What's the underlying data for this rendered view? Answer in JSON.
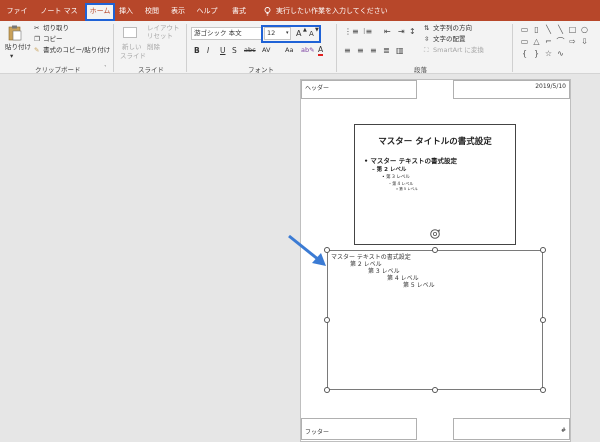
{
  "tabs": [
    {
      "label": "ファイル"
    },
    {
      "label": "ノート マスター"
    },
    {
      "label": "ホーム"
    },
    {
      "label": "挿入"
    },
    {
      "label": "校閲"
    },
    {
      "label": "表示"
    },
    {
      "label": "ヘルプ"
    },
    {
      "label": "書式"
    }
  ],
  "tellme": "実行したい作業を入力してください",
  "clipboard": {
    "paste": "貼り付け",
    "cut": "切り取り",
    "copy": "コピー",
    "format_painter": "書式のコピー/貼り付け",
    "group": "クリップボード"
  },
  "slides": {
    "new_slide": "新しい",
    "new_slide2": "スライド",
    "layout": "レイアウト",
    "reset": "リセット",
    "delete": "削除",
    "group": "スライド"
  },
  "font": {
    "name": "游ゴシック 本文",
    "size": "12",
    "grow": "A",
    "shrink": "A",
    "group": "フォント",
    "bold": "B",
    "italic": "I",
    "underline": "U",
    "shadow": "S",
    "strike": "abc",
    "spacing": "AV",
    "case": "Aa",
    "clear": "A"
  },
  "paragraph": {
    "text_direction": "文字列の方向",
    "align_text": "文字の配置",
    "smartart": "SmartArt に変換",
    "group": "段落"
  },
  "page": {
    "header": "ヘッダー",
    "date": "2019/5/10",
    "footer": "フッター",
    "page_number": "#"
  },
  "slide_thumb": {
    "title": "マスター タイトルの書式設定",
    "l1": "マスター テキストの書式設定",
    "l2": "第 2 レベル",
    "l3": "第 3 レベル",
    "l4": "第 4 レベル",
    "l5": "第 5 レベル"
  },
  "notes": {
    "l1": "マスター テキストの書式設定",
    "l2": "第 2 レベル",
    "l3": "第 3 レベル",
    "l4": "第 4 レベル",
    "l5": "第 5 レベル"
  },
  "colors": {
    "brand": "#b7472a",
    "highlight": "#1f62d6",
    "arrow": "#3b7bd4"
  }
}
